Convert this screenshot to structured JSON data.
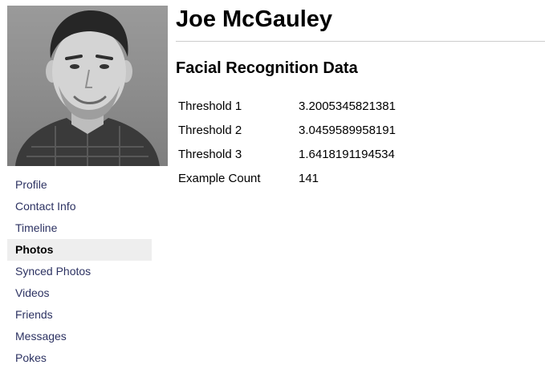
{
  "profile": {
    "name": "Joe McGauley"
  },
  "section": {
    "title": "Facial Recognition Data"
  },
  "facial_data": [
    {
      "key": "Threshold 1",
      "value": "3.2005345821381"
    },
    {
      "key": "Threshold 2",
      "value": "3.0459589958191"
    },
    {
      "key": "Threshold 3",
      "value": "1.6418191194534"
    },
    {
      "key": "Example Count",
      "value": "141"
    }
  ],
  "nav": {
    "active": "Photos",
    "items": [
      {
        "label": "Profile"
      },
      {
        "label": "Contact Info"
      },
      {
        "label": "Timeline"
      },
      {
        "label": "Photos"
      },
      {
        "label": "Synced Photos"
      },
      {
        "label": "Videos"
      },
      {
        "label": "Friends"
      },
      {
        "label": "Messages"
      },
      {
        "label": "Pokes"
      }
    ]
  },
  "colors": {
    "nav_link": "#2c3262",
    "active_bg": "#eeeeee",
    "divider": "#cccccc"
  }
}
